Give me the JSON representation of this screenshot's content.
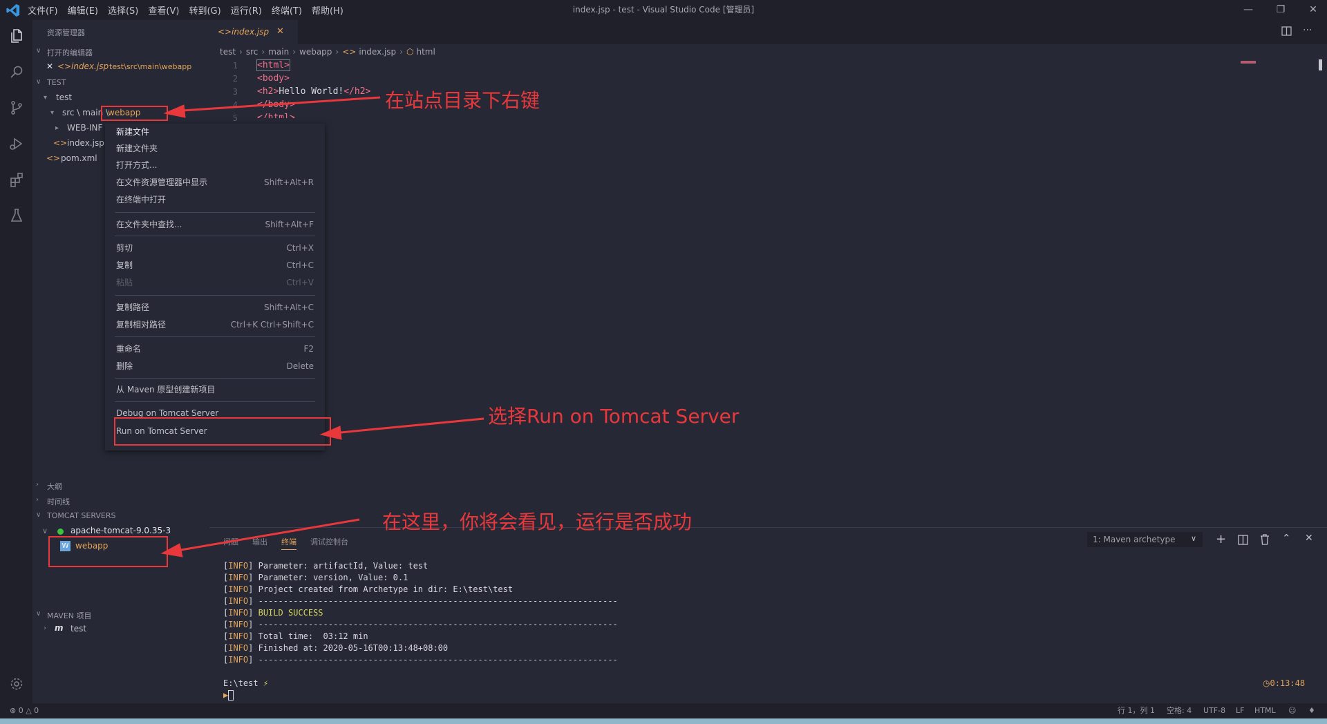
{
  "app": {
    "window_title": "index.jsp - test - Visual Studio Code [管理员]",
    "menu": [
      "文件(F)",
      "编辑(E)",
      "选择(S)",
      "查看(V)",
      "转到(G)",
      "运行(R)",
      "终端(T)",
      "帮助(H)"
    ]
  },
  "sidebar": {
    "explorer_title": "资源管理器",
    "open_editors_title": "打开的编辑器",
    "open_editor": {
      "name": "index.jsp",
      "path": "test\\src\\main\\webapp"
    },
    "workspace_title": "TEST",
    "tree": {
      "root": "test",
      "folder_prefix": "src \\ main \\",
      "folder_selected": "webapp",
      "web_inf": "WEB-INF",
      "index": "index.jsp",
      "pom": "pom.xml"
    },
    "outline_title": "大纲",
    "timeline_title": "时间线",
    "tomcat_title": "TOMCAT SERVERS",
    "tomcat_server": "apache-tomcat-9.0.35-3",
    "tomcat_app": "webapp",
    "maven_title": "MAVEN 项目",
    "maven_item": "test"
  },
  "editor": {
    "tab": "index.jsp",
    "breadcrumb": [
      "test",
      "src",
      "main",
      "webapp",
      "index.jsp",
      "html"
    ],
    "line_numbers": [
      "1",
      "2",
      "3",
      "4",
      "5"
    ],
    "lines": [
      {
        "open": "<html>",
        "text": "",
        "close": ""
      },
      {
        "open": "<body>",
        "text": "",
        "close": ""
      },
      {
        "open": "<h2>",
        "text": "Hello World!",
        "close": "</h2>"
      },
      {
        "open": "</body>",
        "text": "",
        "close": ""
      },
      {
        "open": "</html>",
        "text": "",
        "close": ""
      }
    ]
  },
  "context_menu": {
    "groups": [
      [
        {
          "label": "新建文件",
          "shortcut": ""
        },
        {
          "label": "新建文件夹",
          "shortcut": ""
        },
        {
          "label": "打开方式...",
          "shortcut": ""
        },
        {
          "label": "在文件资源管理器中显示",
          "shortcut": "Shift+Alt+R"
        },
        {
          "label": "在终端中打开",
          "shortcut": ""
        }
      ],
      [
        {
          "label": "在文件夹中查找...",
          "shortcut": "Shift+Alt+F"
        }
      ],
      [
        {
          "label": "剪切",
          "shortcut": "Ctrl+X"
        },
        {
          "label": "复制",
          "shortcut": "Ctrl+C"
        },
        {
          "label": "粘贴",
          "shortcut": "Ctrl+V"
        }
      ],
      [
        {
          "label": "复制路径",
          "shortcut": "Shift+Alt+C"
        },
        {
          "label": "复制相对路径",
          "shortcut": "Ctrl+K Ctrl+Shift+C"
        }
      ],
      [
        {
          "label": "重命名",
          "shortcut": "F2"
        },
        {
          "label": "删除",
          "shortcut": "Delete"
        }
      ],
      [
        {
          "label": "从 Maven 原型创建新项目",
          "shortcut": ""
        }
      ],
      [
        {
          "label": "Debug on Tomcat Server",
          "shortcut": ""
        },
        {
          "label": "Run on Tomcat Server",
          "shortcut": ""
        }
      ]
    ]
  },
  "panel": {
    "tabs": [
      "问题",
      "输出",
      "终端",
      "调试控制台"
    ],
    "active_tab": "终端",
    "terminal_select": "1: Maven archetype",
    "lines": [
      {
        "tag": "INFO",
        "text": " Parameter: artifactId, Value: test"
      },
      {
        "tag": "INFO",
        "text": " Parameter: version, Value: 0.1"
      },
      {
        "tag": "INFO",
        "text": " Project created from Archetype in dir: E:\\test\\test"
      },
      {
        "tag": "INFO",
        "text": " ------------------------------------------------------------------------"
      },
      {
        "tag": "INFO",
        "text": " BUILD SUCCESS"
      },
      {
        "tag": "INFO",
        "text": " ------------------------------------------------------------------------"
      },
      {
        "tag": "INFO",
        "text": " Total time:  03:12 min"
      },
      {
        "tag": "INFO",
        "text": " Finished at: 2020-05-16T00:13:48+08:00"
      },
      {
        "tag": "INFO",
        "text": " ------------------------------------------------------------------------"
      }
    ],
    "prompt": "E:\\test",
    "time": "0:13:48"
  },
  "statusbar": {
    "errors": "0",
    "warnings": "0",
    "position": "行 1，列 1",
    "spaces": "空格: 4",
    "encoding": "UTF-8",
    "eol": "LF",
    "language": "HTML"
  },
  "annotations": {
    "a1": "在站点目录下右键",
    "a2": "选择Run on Tomcat Server",
    "a3": "在这里，你将会看见，运行是否成功"
  },
  "colors": {
    "accent_orange": "#e4a45a",
    "annotation_red": "#e8383b",
    "tag_pink": "#f0718a",
    "success_green": "#3ec13e",
    "build_success_yellow": "#d7d75e"
  }
}
